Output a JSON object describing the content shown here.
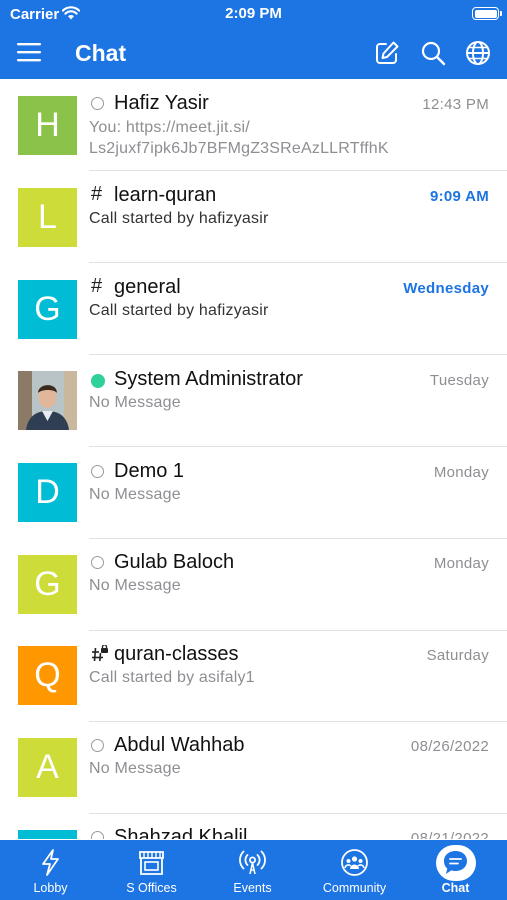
{
  "status_bar": {
    "carrier": "Carrier",
    "time": "2:09 PM"
  },
  "header": {
    "title": "Chat",
    "icons": [
      "menu-icon",
      "edit-icon",
      "search-icon",
      "globe-icon"
    ],
    "color": "#1d74e3"
  },
  "chats": [
    {
      "initial": "H",
      "avatar_color": "#8bc34a",
      "status": "offline",
      "name": "Hafiz Yasir",
      "time": "12:43 PM",
      "time_unread": false,
      "preview": "You: https://meet.jit.si/",
      "preview2": "Ls2juxf7ipk6Jb7BFMgZ3SReAzLLRTffhK",
      "unread": false
    },
    {
      "initial": "L",
      "avatar_color": "#cddc39",
      "status": "channel",
      "name": "learn-quran",
      "time": "9:09 AM",
      "time_unread": true,
      "preview": "Call started by hafizyasir",
      "unread": true
    },
    {
      "initial": "G",
      "avatar_color": "#00bcd4",
      "status": "channel",
      "name": "general",
      "time": "Wednesday",
      "time_unread": true,
      "preview": "Call started by hafizyasir",
      "unread": true
    },
    {
      "initial": "",
      "avatar_color": "#7a8a90",
      "avatar_icon": "user-photo",
      "status": "online",
      "name": "System Administrator",
      "time": "Tuesday",
      "time_unread": false,
      "preview": "No Message",
      "unread": false
    },
    {
      "initial": "D",
      "avatar_color": "#00bcd4",
      "status": "offline",
      "name": "Demo 1",
      "time": "Monday",
      "time_unread": false,
      "preview": "No Message",
      "unread": false
    },
    {
      "initial": "G",
      "avatar_color": "#cddc39",
      "status": "offline",
      "name": "Gulab Baloch",
      "time": "Monday",
      "time_unread": false,
      "preview": "No Message",
      "unread": false
    },
    {
      "initial": "Q",
      "avatar_color": "#ff9800",
      "status": "private-channel",
      "name": "quran-classes",
      "time": "Saturday",
      "time_unread": false,
      "preview": "Call started by asifaly1",
      "unread": false
    },
    {
      "initial": "A",
      "avatar_color": "#cddc39",
      "status": "offline",
      "name": "Abdul Wahhab",
      "time": "08/26/2022",
      "time_unread": false,
      "preview": "No Message",
      "unread": false
    },
    {
      "initial": "",
      "avatar_color": "#00bcd4",
      "status": "offline",
      "name": "Shahzad Khalil",
      "time": "08/21/2022",
      "time_unread": false,
      "preview": "",
      "unread": false
    }
  ],
  "tabs": [
    {
      "label": "Lobby",
      "icon": "lightning-icon",
      "active": false
    },
    {
      "label": "S Offices",
      "icon": "store-icon",
      "active": false
    },
    {
      "label": "Events",
      "icon": "broadcast-icon",
      "active": false
    },
    {
      "label": "Community",
      "icon": "community-icon",
      "active": false
    },
    {
      "label": "Chat",
      "icon": "chat-bubble-icon",
      "active": true
    }
  ]
}
